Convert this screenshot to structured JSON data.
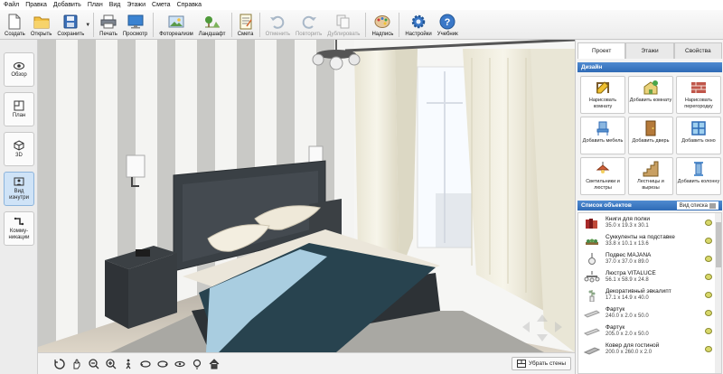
{
  "menu": [
    "Файл",
    "Правка",
    "Добавить",
    "План",
    "Вид",
    "Этажи",
    "Смета",
    "Справка"
  ],
  "toolbar": {
    "create": "Создать",
    "open": "Открыть",
    "save": "Сохранить",
    "print": "Печать",
    "preview": "Просмотр",
    "photoreal": "Фотореализм",
    "landscape": "Ландшафт",
    "estimate": "Смета",
    "undo": "Отменить",
    "redo": "Повторить",
    "duplicate": "Дублировать",
    "label": "Надпись",
    "settings": "Настройки",
    "tutorial": "Учебник"
  },
  "leftbar": {
    "overview": "Обзор",
    "plan": "План",
    "view3d": "3D",
    "inside": "Вид изнутри",
    "community": "Комму-никации"
  },
  "bottombar": {
    "remove_walls": "Убрать стены"
  },
  "tabs": [
    "Проект",
    "Этажи",
    "Свойства"
  ],
  "design": {
    "title": "Дизайн",
    "buttons": [
      "Нарисовать комнату",
      "Добавить комнату",
      "Нарисовать перегородку",
      "Добавить мебель",
      "Добавить дверь",
      "Добавить окно",
      "Светильники и люстры",
      "Лестницы и вырезы",
      "Добавить колонну"
    ]
  },
  "objects": {
    "title": "Список объектов",
    "view_list": "Вид списка",
    "items": [
      {
        "name": "Книги для полки",
        "dims": "35.0 x 19.3 x 30.1"
      },
      {
        "name": "Суккуленты на подставке",
        "dims": "33.8 x 10.1 x 13.6"
      },
      {
        "name": "Подвес MAJANA",
        "dims": "37.0 x 37.0 x 89.0"
      },
      {
        "name": "Люстра VITALUCE",
        "dims": "56.1 x 58.9 x 24.8"
      },
      {
        "name": "Декоративный эвкалипт",
        "dims": "17.1 x 14.9 x 40.0"
      },
      {
        "name": "Фартук",
        "dims": "240.0 x 2.0 x 50.0"
      },
      {
        "name": "Фартук",
        "dims": "205.0 x 2.0 x 50.0"
      },
      {
        "name": "Ковер для гостиной",
        "dims": "200.0 x 260.0 x 2.0"
      }
    ]
  },
  "colors": {
    "accent": "#2f6bb6",
    "active_tab": "#cfe3f7"
  }
}
